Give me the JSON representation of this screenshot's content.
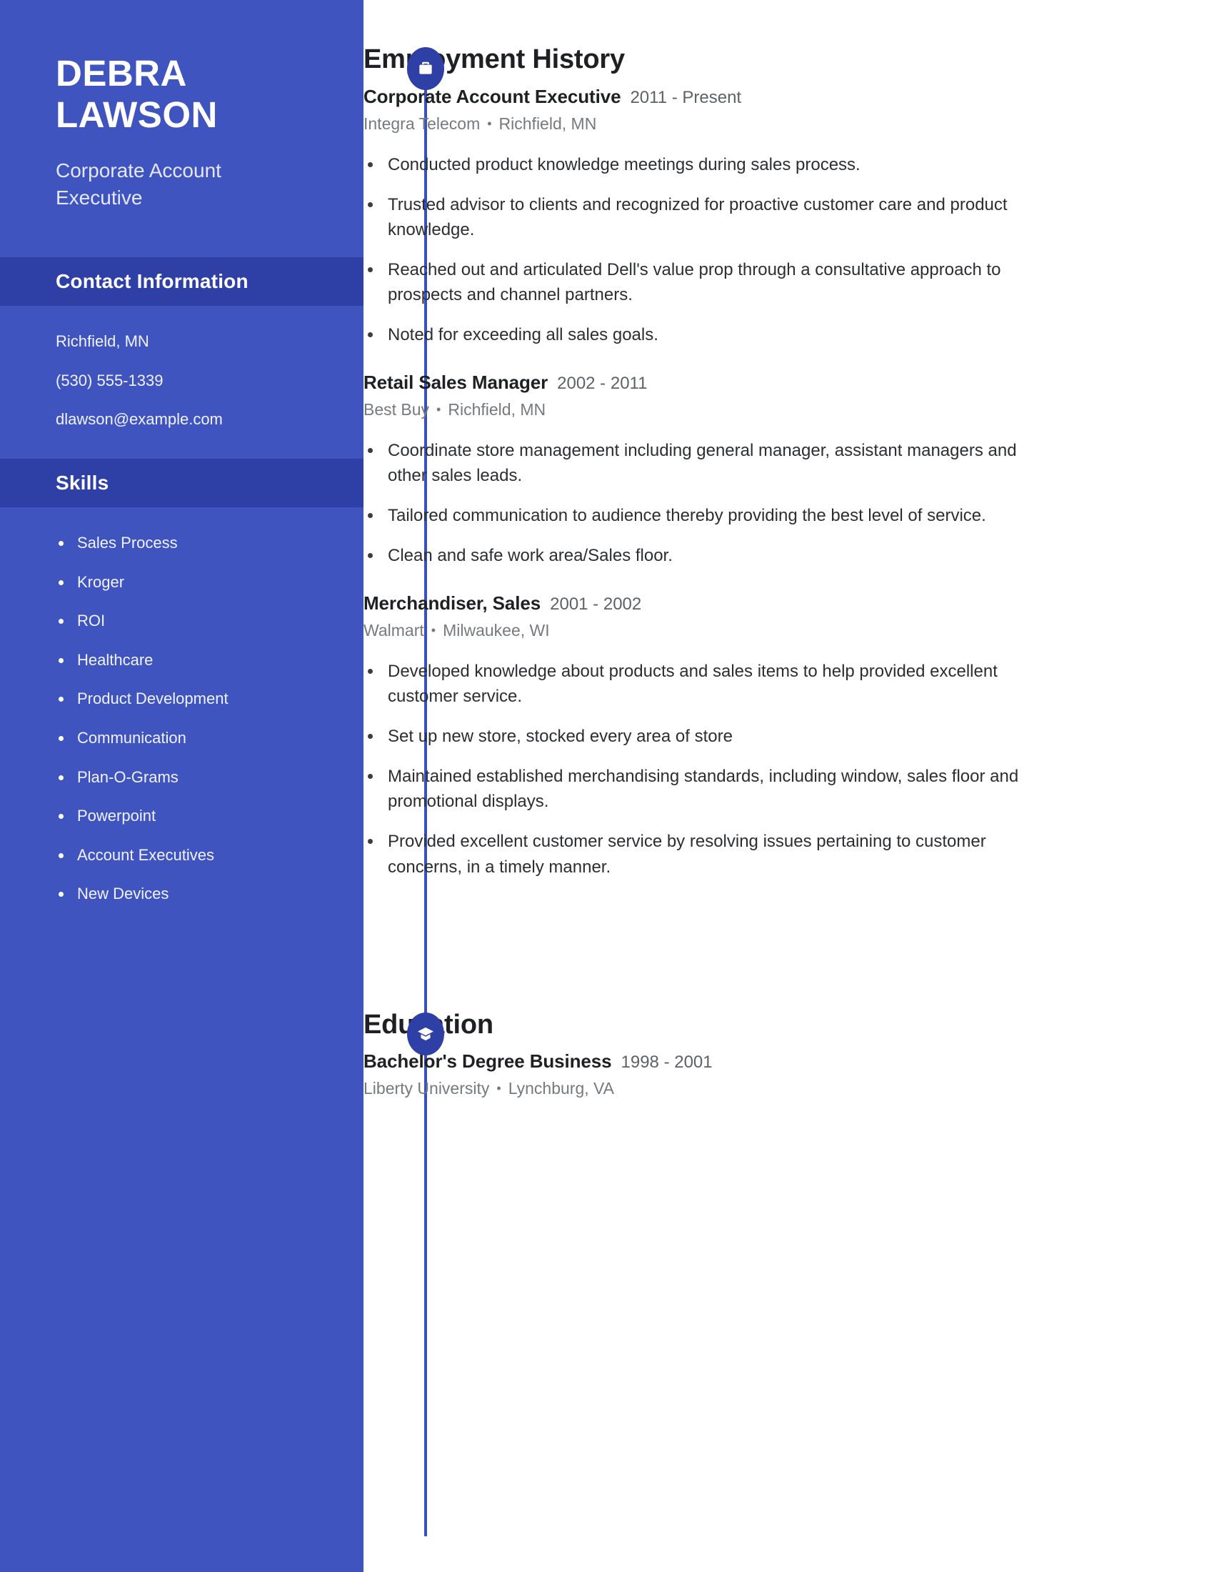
{
  "sidebar": {
    "name_first": "DEBRA",
    "name_last": "LAWSON",
    "job_title": "Corporate Account Executive",
    "contact_section_title": "Contact Information",
    "contact": {
      "location": "Richfield, MN",
      "phone": "(530) 555-1339",
      "email": "dlawson@example.com"
    },
    "skills_section_title": "Skills",
    "skills": [
      "Sales Process",
      "Kroger",
      "ROI",
      "Healthcare",
      "Product Development",
      "Communication",
      "Plan-O-Grams",
      "Powerpoint",
      "Account Executives",
      "New Devices"
    ]
  },
  "main": {
    "employment": {
      "heading": "Employment History",
      "icon": "briefcase-icon",
      "entries": [
        {
          "role": "Corporate Account Executive",
          "dates": "2011 - Present",
          "company": "Integra Telecom",
          "location": "Richfield, MN",
          "bullets": [
            "Conducted product knowledge meetings during sales process.",
            "Trusted advisor to clients and recognized for proactive customer care and product knowledge.",
            "Reached out and articulated Dell's value prop through a consultative approach to prospects and channel partners.",
            "Noted for exceeding all sales goals."
          ]
        },
        {
          "role": "Retail Sales Manager",
          "dates": "2002 - 2011",
          "company": "Best Buy",
          "location": "Richfield, MN",
          "bullets": [
            "Coordinate store management including general manager, assistant managers and other sales leads.",
            "Tailored communication to audience thereby providing the best level of service.",
            "Clean and safe work area/Sales floor."
          ]
        },
        {
          "role": "Merchandiser, Sales",
          "dates": "2001 - 2002",
          "company": "Walmart",
          "location": "Milwaukee, WI",
          "bullets": [
            "Developed knowledge about products and sales items to help provided excellent customer service.",
            "Set up new store, stocked every area of store",
            "Maintained established merchandising standards, including window, sales floor and promotional displays.",
            "Provided excellent customer service by resolving issues pertaining to customer concerns, in a timely manner."
          ]
        }
      ]
    },
    "education": {
      "heading": "Education",
      "icon": "graduation-cap-icon",
      "entries": [
        {
          "degree": "Bachelor's Degree Business",
          "dates": "1998 - 2001",
          "school": "Liberty University",
          "location": "Lynchburg, VA"
        }
      ]
    }
  },
  "theme": {
    "sidebar_bg": "#4054c0",
    "band_bg": "#2e3fa5",
    "accent": "#3a4fc0",
    "text_dark": "#1f2023",
    "text_muted": "#76797e"
  }
}
